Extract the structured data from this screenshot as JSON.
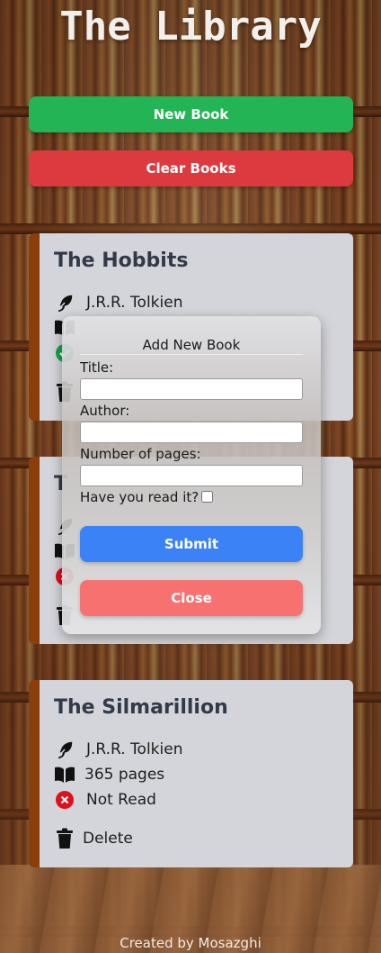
{
  "header": {
    "title": "The Library"
  },
  "actions": {
    "new_book": "New Book",
    "clear_books": "Clear Books"
  },
  "books": [
    {
      "title": "The Hobbits",
      "author": "J.R.R. Tolkien",
      "pages": "",
      "status": "",
      "delete": "Delete"
    },
    {
      "title": "T",
      "author": "",
      "pages": "",
      "status": "",
      "delete": ""
    },
    {
      "title": "The Silmarillion",
      "author": "J.R.R. Tolkien",
      "pages": "365 pages",
      "status": "Not Read",
      "delete": "Delete"
    }
  ],
  "modal": {
    "title": "Add New Book",
    "title_label": "Title:",
    "title_value": "",
    "author_label": "Author:",
    "author_value": "",
    "pages_label": "Number of pages:",
    "pages_value": "",
    "read_label": "Have you read it?",
    "read_checked": false,
    "submit": "Submit",
    "close": "Close"
  },
  "footer": {
    "text": "Created by Mosazghi"
  },
  "colors": {
    "new_button": "#22b455",
    "clear_button": "#dc3a3f",
    "submit_button": "#3b82f6",
    "close_button": "#f87171",
    "card_accent": "#8b3e0b",
    "read_icon": "#16a34a",
    "not_read_icon": "#e0101a"
  },
  "icons": {
    "author": "feather-icon",
    "pages": "open-book-icon",
    "read": "check-circle-icon",
    "not_read": "x-circle-icon",
    "delete": "trash-icon"
  }
}
